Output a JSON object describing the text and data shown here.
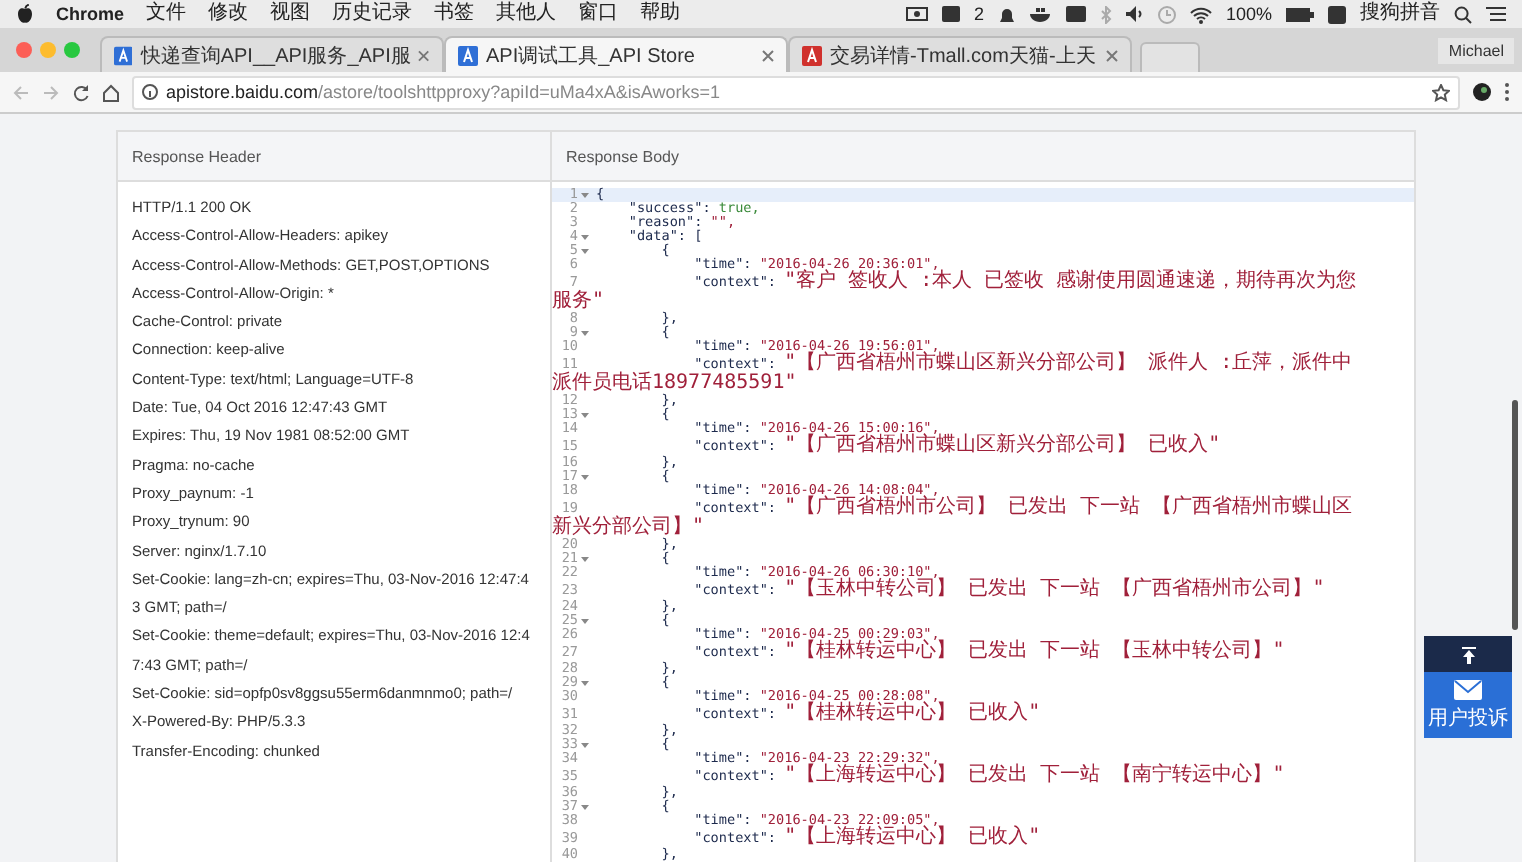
{
  "menu_bar": {
    "app": "Chrome",
    "menus": [
      "文件",
      "修改",
      "视图",
      "历史记录",
      "书签",
      "其他人",
      "窗口",
      "帮助"
    ],
    "status": {
      "notification_count": "2",
      "battery": "100%",
      "input_method": "搜狗拼音"
    }
  },
  "tabs": [
    {
      "title": "快递查询API__API服务_API服",
      "selected": false,
      "color": "#2f6fd6"
    },
    {
      "title": "API调试工具_API Store",
      "selected": true,
      "color": "#2f6fd6"
    },
    {
      "title": "交易详情-Tmall.com天猫-上天",
      "selected": false,
      "color": "#d0312d"
    }
  ],
  "profile": "Michael",
  "address": {
    "host": "apistore.baidu.com",
    "path": "/astore/toolshttpproxy?apiId=uMa4xA&isAworks=1"
  },
  "response_header": {
    "title": "Response Header",
    "lines": [
      "HTTP/1.1 200 OK",
      "Access-Control-Allow-Headers: apikey",
      "Access-Control-Allow-Methods: GET,POST,OPTIONS",
      "Access-Control-Allow-Origin: *",
      "Cache-Control: private",
      "Connection: keep-alive",
      "Content-Type: text/html; Language=UTF-8",
      "Date: Tue, 04 Oct 2016 12:47:43 GMT",
      "Expires: Thu, 19 Nov 1981 08:52:00 GMT",
      "Pragma: no-cache",
      "Proxy_paynum: -1",
      "Proxy_trynum: 90",
      "Server: nginx/1.7.10",
      "Set-Cookie: lang=zh-cn; expires=Thu, 03-Nov-2016 12:47:43 GMT; path=/",
      "Set-Cookie: theme=default; expires=Thu, 03-Nov-2016 12:47:43 GMT; path=/",
      "Set-Cookie: sid=opfp0sv8ggsu55erm6danmnmo0; path=/",
      "X-Powered-By: PHP/5.3.3",
      "Transfer-Encoding: chunked"
    ]
  },
  "response_body": {
    "title": "Response Body",
    "lines": [
      {
        "number": "1",
        "fold": true,
        "highlighted": true,
        "kind": "brace",
        "code": "{"
      },
      {
        "number": "2",
        "fold": false,
        "highlighted": false,
        "code": "    \"success\": ",
        "value": "true,",
        "kind": "bool"
      },
      {
        "number": "3",
        "fold": false,
        "highlighted": false,
        "code": "    \"reason\": ",
        "value": "\"\",",
        "kind": "string"
      },
      {
        "number": "4",
        "fold": true,
        "highlighted": false,
        "kind": "brace",
        "code": "    \"data\": ["
      },
      {
        "number": "5",
        "fold": true,
        "highlighted": false,
        "kind": "brace",
        "code": "        {"
      },
      {
        "number": "6",
        "fold": false,
        "highlighted": false,
        "code": "            \"time\": ",
        "value": "\"2016-04-26 20:36:01\",",
        "kind": "string"
      },
      {
        "number": "7",
        "fold": false,
        "highlighted": false,
        "code": "            \"context\": ",
        "value": "\"客户 签收人 :本人 已签收 感谢使用圆通速递，期待再次为您",
        "kind": "text",
        "wrap": "服务\""
      },
      {
        "number": "8",
        "fold": false,
        "highlighted": false,
        "kind": "brace",
        "code": "        },"
      },
      {
        "number": "9",
        "fold": true,
        "highlighted": false,
        "kind": "brace",
        "code": "        {"
      },
      {
        "number": "10",
        "fold": false,
        "highlighted": false,
        "code": "            \"time\": ",
        "value": "\"2016-04-26 19:56:01\",",
        "kind": "string"
      },
      {
        "number": "11",
        "fold": false,
        "highlighted": false,
        "code": "            \"context\": ",
        "value": "\"【广西省梧州市蝶山区新兴分部公司】 派件人 :丘萍，派件中",
        "kind": "text",
        "wrap": "派件员电话18977485591\""
      },
      {
        "number": "12",
        "fold": false,
        "highlighted": false,
        "kind": "brace",
        "code": "        },"
      },
      {
        "number": "13",
        "fold": true,
        "highlighted": false,
        "kind": "brace",
        "code": "        {"
      },
      {
        "number": "14",
        "fold": false,
        "highlighted": false,
        "code": "            \"time\": ",
        "value": "\"2016-04-26 15:00:16\",",
        "kind": "string"
      },
      {
        "number": "15",
        "fold": false,
        "highlighted": false,
        "code": "            \"context\": ",
        "value": "\"【广西省梧州市蝶山区新兴分部公司】 已收入\"",
        "kind": "text"
      },
      {
        "number": "16",
        "fold": false,
        "highlighted": false,
        "kind": "brace",
        "code": "        },"
      },
      {
        "number": "17",
        "fold": true,
        "highlighted": false,
        "kind": "brace",
        "code": "        {"
      },
      {
        "number": "18",
        "fold": false,
        "highlighted": false,
        "code": "            \"time\": ",
        "value": "\"2016-04-26 14:08:04\",",
        "kind": "string"
      },
      {
        "number": "19",
        "fold": false,
        "highlighted": false,
        "code": "            \"context\": ",
        "value": "\"【广西省梧州市公司】 已发出 下一站 【广西省梧州市蝶山区",
        "kind": "text",
        "wrap": "新兴分部公司】\""
      },
      {
        "number": "20",
        "fold": false,
        "highlighted": false,
        "kind": "brace",
        "code": "        },"
      },
      {
        "number": "21",
        "fold": true,
        "highlighted": false,
        "kind": "brace",
        "code": "        {"
      },
      {
        "number": "22",
        "fold": false,
        "highlighted": false,
        "code": "            \"time\": ",
        "value": "\"2016-04-26 06:30:10\",",
        "kind": "string"
      },
      {
        "number": "23",
        "fold": false,
        "highlighted": false,
        "code": "            \"context\": ",
        "value": "\"【玉林中转公司】 已发出 下一站 【广西省梧州市公司】\"",
        "kind": "text"
      },
      {
        "number": "24",
        "fold": false,
        "highlighted": false,
        "kind": "brace",
        "code": "        },"
      },
      {
        "number": "25",
        "fold": true,
        "highlighted": false,
        "kind": "brace",
        "code": "        {"
      },
      {
        "number": "26",
        "fold": false,
        "highlighted": false,
        "code": "            \"time\": ",
        "value": "\"2016-04-25 00:29:03\",",
        "kind": "string"
      },
      {
        "number": "27",
        "fold": false,
        "highlighted": false,
        "code": "            \"context\": ",
        "value": "\"【桂林转运中心】 已发出 下一站 【玉林中转公司】\"",
        "kind": "text"
      },
      {
        "number": "28",
        "fold": false,
        "highlighted": false,
        "kind": "brace",
        "code": "        },"
      },
      {
        "number": "29",
        "fold": true,
        "highlighted": false,
        "kind": "brace",
        "code": "        {"
      },
      {
        "number": "30",
        "fold": false,
        "highlighted": false,
        "code": "            \"time\": ",
        "value": "\"2016-04-25 00:28:08\",",
        "kind": "string"
      },
      {
        "number": "31",
        "fold": false,
        "highlighted": false,
        "code": "            \"context\": ",
        "value": "\"【桂林转运中心】 已收入\"",
        "kind": "text"
      },
      {
        "number": "32",
        "fold": false,
        "highlighted": false,
        "kind": "brace",
        "code": "        },"
      },
      {
        "number": "33",
        "fold": true,
        "highlighted": false,
        "kind": "brace",
        "code": "        {"
      },
      {
        "number": "34",
        "fold": false,
        "highlighted": false,
        "code": "            \"time\": ",
        "value": "\"2016-04-23 22:29:32\",",
        "kind": "string"
      },
      {
        "number": "35",
        "fold": false,
        "highlighted": false,
        "code": "            \"context\": ",
        "value": "\"【上海转运中心】 已发出 下一站 【南宁转运中心】\"",
        "kind": "text"
      },
      {
        "number": "36",
        "fold": false,
        "highlighted": false,
        "kind": "brace",
        "code": "        },"
      },
      {
        "number": "37",
        "fold": true,
        "highlighted": false,
        "kind": "brace",
        "code": "        {"
      },
      {
        "number": "38",
        "fold": false,
        "highlighted": false,
        "code": "            \"time\": ",
        "value": "\"2016-04-23 22:09:05\",",
        "kind": "string"
      },
      {
        "number": "39",
        "fold": false,
        "highlighted": false,
        "code": "            \"context\": ",
        "value": "\"【上海转运中心】 已收入\"",
        "kind": "text"
      },
      {
        "number": "40",
        "fold": false,
        "highlighted": false,
        "kind": "brace",
        "code": "        },"
      }
    ]
  },
  "float_buttons": {
    "complaint": "用户投诉"
  }
}
